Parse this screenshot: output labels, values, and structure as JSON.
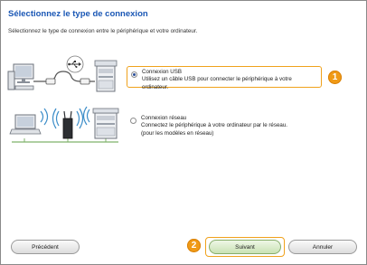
{
  "dialog": {
    "title": "Sélectionnez le type de connexion",
    "subtitle": "Sélectionnez le type de connexion entre le périphérique et votre ordinateur."
  },
  "options": {
    "usb": {
      "title": "Connexion USB",
      "description": "Utilisez un câble USB pour connecter le périphérique à votre ordinateur.",
      "selected": true
    },
    "network": {
      "title": "Connexion réseau",
      "description_line1": "Connectez le périphérique à votre ordinateur par le réseau.",
      "description_line2": "(pour les modèles en réseau)",
      "selected": false
    }
  },
  "callouts": {
    "one": "1",
    "two": "2"
  },
  "buttons": {
    "previous": "Précédent",
    "next": "Suivant",
    "cancel": "Annuler"
  },
  "icons": {
    "usb_symbol": "usb-icon",
    "wifi": "wifi-icon",
    "computer": "computer-icon",
    "printer": "printer-icon",
    "router": "router-icon"
  },
  "colors": {
    "title": "#1a57b5",
    "highlight": "#f0a21c",
    "badge": "#f09a16",
    "next_button": "#c9e2b4"
  }
}
